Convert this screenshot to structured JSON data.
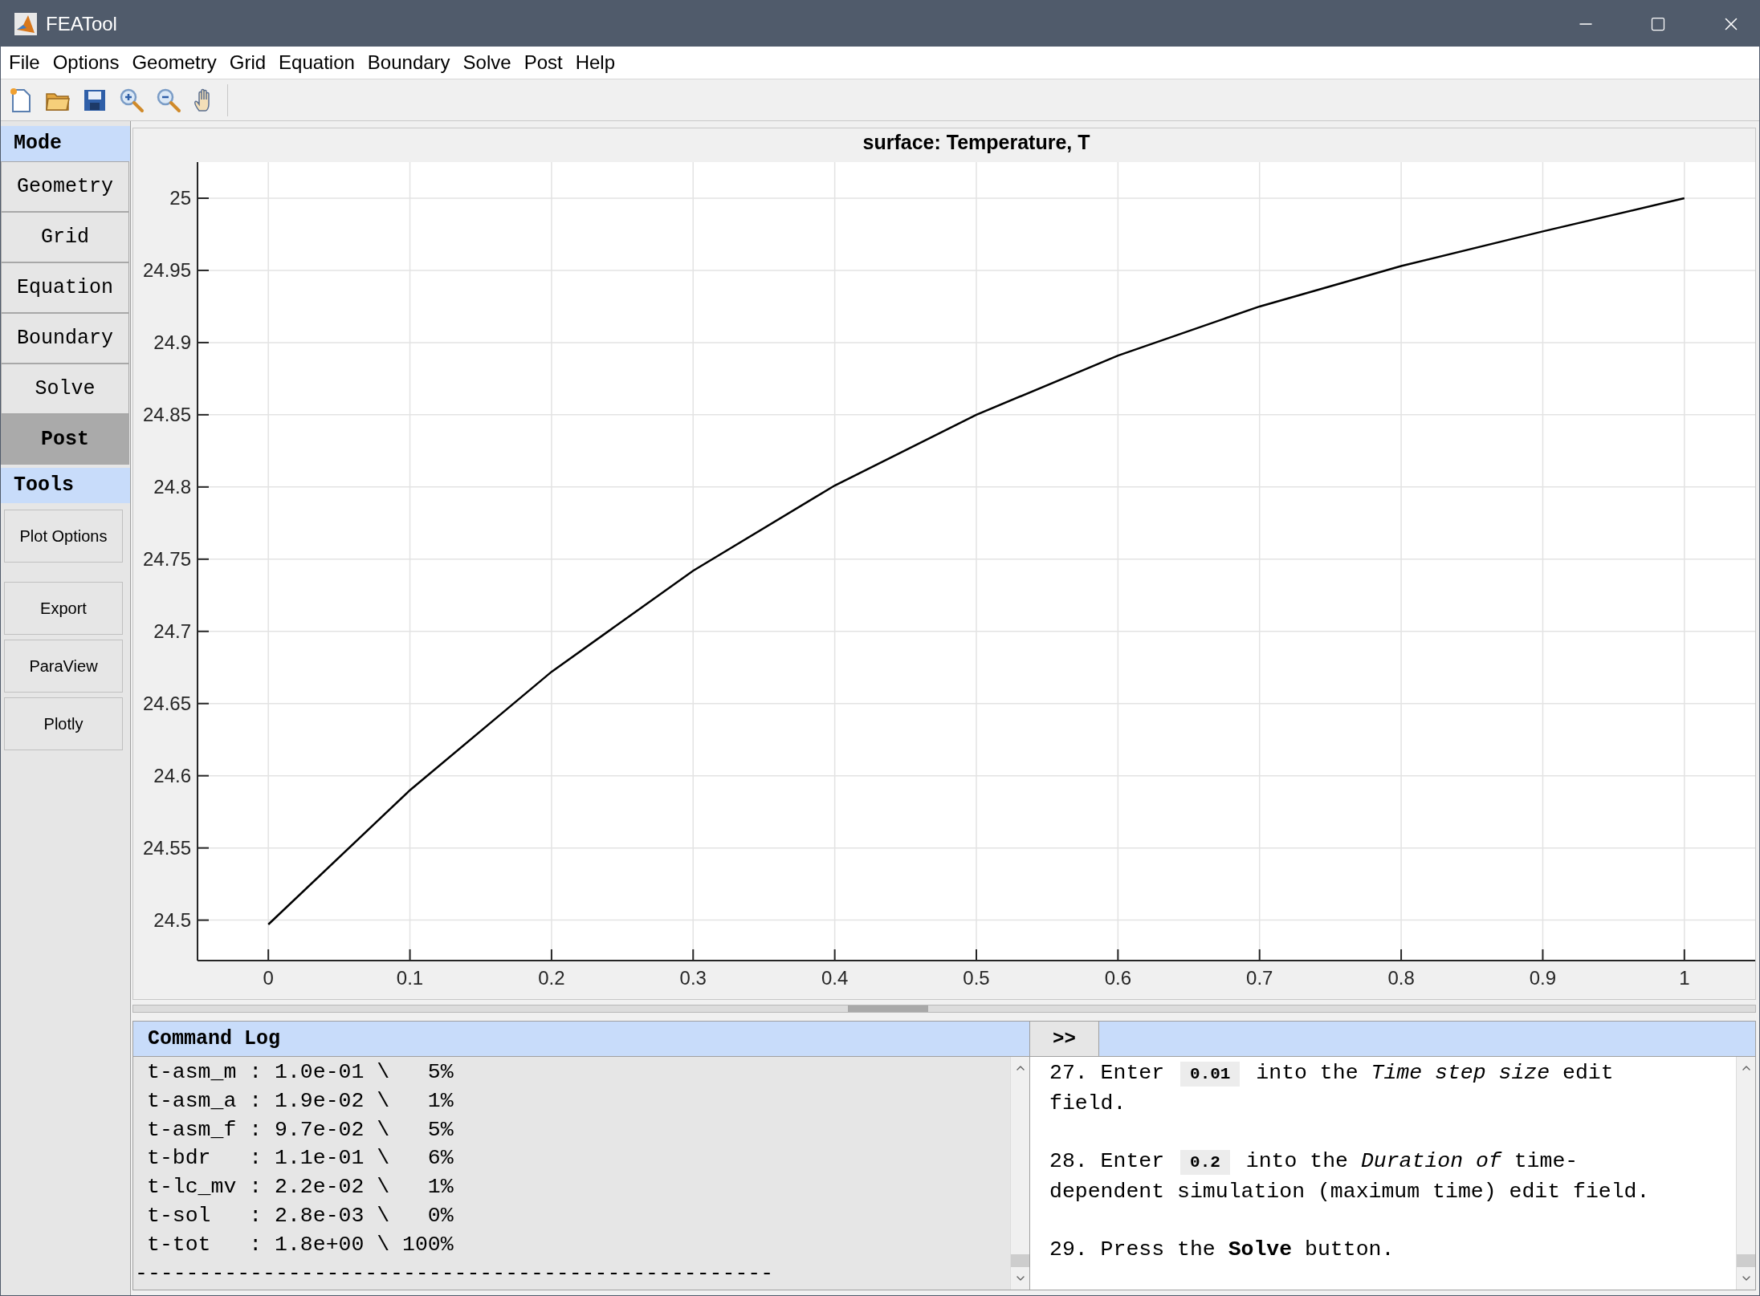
{
  "window": {
    "title": "FEATool"
  },
  "menu": [
    "File",
    "Options",
    "Geometry",
    "Grid",
    "Equation",
    "Boundary",
    "Solve",
    "Post",
    "Help"
  ],
  "sidebar": {
    "mode_header": "Mode",
    "modes": [
      {
        "label": "Geometry",
        "selected": false
      },
      {
        "label": "Grid",
        "selected": false
      },
      {
        "label": "Equation",
        "selected": false
      },
      {
        "label": "Boundary",
        "selected": false
      },
      {
        "label": "Solve",
        "selected": false
      },
      {
        "label": "Post",
        "selected": true
      }
    ],
    "tools_header": "Tools",
    "tools": [
      "Plot Options",
      "Export",
      "ParaView",
      "Plotly"
    ]
  },
  "plot": {
    "chart_data": {
      "type": "line",
      "title": "surface: Temperature, T",
      "x": [
        0,
        0.1,
        0.2,
        0.3,
        0.4,
        0.5,
        0.6,
        0.7,
        0.8,
        0.9,
        1
      ],
      "grid": true,
      "series": [
        {
          "color": "#000000",
          "values": [
            24.497,
            24.59,
            24.672,
            24.742,
            24.801,
            24.85,
            24.891,
            24.925,
            24.953,
            24.977,
            25
          ]
        }
      ],
      "xlim": [
        -0.05,
        1.05
      ],
      "ylim": [
        24.472,
        25.025
      ],
      "xticks": [
        0,
        0.1,
        0.2,
        0.3,
        0.4,
        0.5,
        0.6,
        0.7,
        0.8,
        0.9,
        1
      ],
      "yticks": [
        24.5,
        24.55,
        24.6,
        24.65,
        24.7,
        24.75,
        24.8,
        24.85,
        24.9,
        24.95,
        25
      ]
    }
  },
  "command_log": {
    "title": "Command Log",
    "lines": [
      "t-asm_m : 1.0e-01 \\   5%",
      "t-asm_a : 1.9e-02 \\   1%",
      "t-asm_f : 9.7e-02 \\   5%",
      "t-bdr   : 1.1e-01 \\   6%",
      "t-lc_mv : 2.2e-02 \\   1%",
      "t-sol   : 2.8e-03 \\   0%",
      "t-tot   : 1.8e+00 \\ 100%"
    ],
    "separator": "--------------------------------------------------"
  },
  "guide": {
    "button": ">>",
    "steps": [
      {
        "segments": [
          {
            "kind": "text",
            "text": "27. Enter "
          },
          {
            "kind": "code",
            "text": "0.01"
          },
          {
            "kind": "text",
            "text": " into the *Time step size* edit field."
          }
        ]
      },
      {
        "segments": [
          {
            "kind": "text",
            "text": "28. Enter "
          },
          {
            "kind": "code",
            "text": "0.2"
          },
          {
            "kind": "text",
            "text": " into the *Duration of* time-dependent simulation (maximum time) edit field."
          }
        ]
      },
      {
        "segments": [
          {
            "kind": "text",
            "text": "29. Press the **Solve** button."
          }
        ]
      }
    ]
  }
}
